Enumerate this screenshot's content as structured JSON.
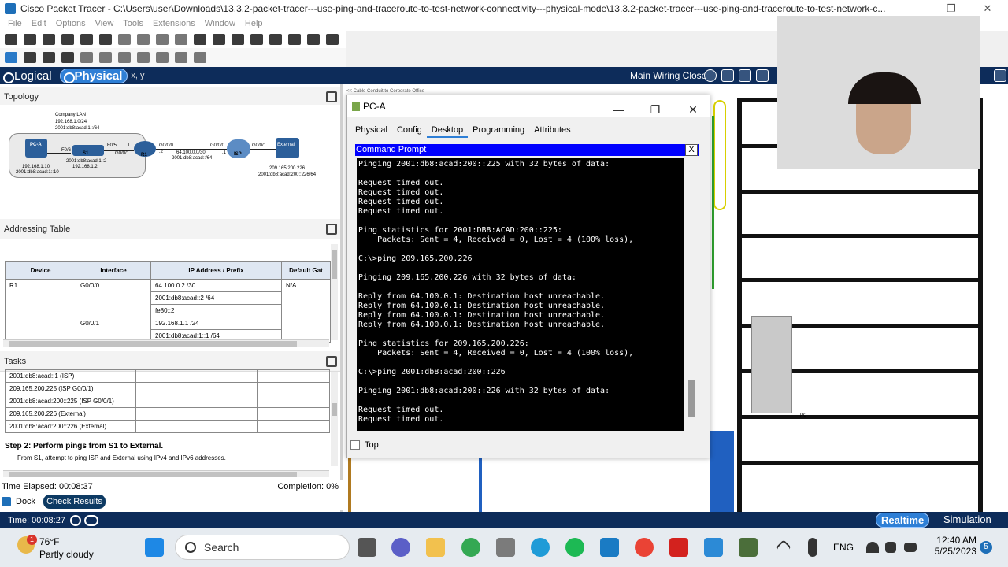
{
  "window": {
    "title": "Cisco Packet Tracer - C:\\Users\\user\\Downloads\\13.3.2-packet-tracer---use-ping-and-traceroute-to-test-network-connectivity---physical-mode\\13.3.2-packet-tracer---use-ping-and-traceroute-to-test-network-c...",
    "minimize": "—",
    "maximize": "❐",
    "close": "✕"
  },
  "menu": [
    "File",
    "Edit",
    "Options",
    "View",
    "Tools",
    "Extensions",
    "Window",
    "Help"
  ],
  "modebar": {
    "logical": "Logical",
    "physical": "Physical",
    "xy": "x, y",
    "location": "Main Wiring Closet"
  },
  "topology": {
    "header": "Topology",
    "lan_label": "Company LAN",
    "lan_net": "192.168.1.0/24",
    "lan_v6": "2001:db8:acad:1::/64",
    "pca": "PC-A",
    "pca_ip": "192.168.1.10",
    "pca_v6": "2001:db8:acad:1::10",
    "s1": "S1",
    "s1_v6": "2001:db8:acad:1::2",
    "s1_ip": "192.168.1.2",
    "f06": "F0/6",
    "f05": "F0/5",
    "g001": "G0/0/1",
    "r1": "R1",
    "g000": "G0/0/0",
    "wan_net": "64.100.0.0/30",
    "wan_v6": "2001:db8:acad::/64",
    "isp": "ISP",
    "isp_g000": "G0/0/0",
    "isp_g001": "G0/0/1",
    "external": "External",
    "ext_ip": "209.165.200.226",
    "ext_v6": "2001:db8:acad:200::226/64",
    "dot1": ".1",
    "dot2": ".2",
    "dot1b": ".1"
  },
  "addressing": {
    "header": "Addressing Table",
    "columns": [
      "Device",
      "Interface",
      "IP Address / Prefix",
      "Default Gat"
    ],
    "rows": [
      [
        "R1",
        "G0/0/0",
        "64.100.0.2 /30",
        "N/A"
      ],
      [
        "",
        "",
        "2001:db8:acad::2 /64",
        ""
      ],
      [
        "",
        "",
        "fe80::2",
        ""
      ],
      [
        "",
        "G0/0/1",
        "192.168.1.1 /24",
        ""
      ],
      [
        "",
        "",
        "2001:db8:acad:1::1 /64",
        ""
      ]
    ]
  },
  "tasks": {
    "header": "Tasks",
    "rows": [
      "2001:db8:acad::1 (ISP)",
      "209.165.200.225 (ISP G0/0/1)",
      "2001:db8:acad:200::225 (ISP G0/0/1)",
      "209.165.200.226 (External)",
      "2001:db8:acad:200::226 (External)"
    ],
    "step_title": "Step 2: Perform pings from S1 to External.",
    "step_desc": "From S1, attempt to ping ISP and External using IPv4 and IPv6 addresses."
  },
  "footer": {
    "elapsed": "Time Elapsed: 00:08:37",
    "completion": "Completion: 0%",
    "dock": "Dock",
    "check": "Check Results",
    "time": "Time: 00:08:27",
    "realtime": "Realtime",
    "simulation": "Simulation"
  },
  "pcwin": {
    "title": "PC-A",
    "tabs": [
      "Physical",
      "Config",
      "Desktop",
      "Programming",
      "Attributes"
    ],
    "active_tab": "Desktop",
    "cmd_title": "Command Prompt",
    "cmd_close": "X",
    "top_label": "Top",
    "terminal": "Pinging 2001:db8:acad:200::225 with 32 bytes of data:\n\nRequest timed out.\nRequest timed out.\nRequest timed out.\nRequest timed out.\n\nPing statistics for 2001:DB8:ACAD:200::225:\n    Packets: Sent = 4, Received = 0, Lost = 4 (100% loss),\n\nC:\\>ping 209.165.200.226\n\nPinging 209.165.200.226 with 32 bytes of data:\n\nReply from 64.100.0.1: Destination host unreachable.\nReply from 64.100.0.1: Destination host unreachable.\nReply from 64.100.0.1: Destination host unreachable.\nReply from 64.100.0.1: Destination host unreachable.\n\nPing statistics for 209.165.200.226:\n    Packets: Sent = 4, Received = 0, Lost = 4 (100% loss),\n\nC:\\>ping 2001:db8:acad:200::226\n\nPinging 2001:db8:acad:200::226 with 32 bytes of data:\n\nRequest timed out.\nRequest timed out.\n"
  },
  "workspace": {
    "breadcrumb": "<< Cable Conduit to Corporate Office",
    "pc_label": "PC"
  },
  "taskbar": {
    "weather_temp": "76°F",
    "weather_desc": "Partly cloudy",
    "weather_badge": "1",
    "search": "Search",
    "lang": "ENG",
    "time": "12:40 AM",
    "date": "5/25/2023",
    "notif": "5"
  },
  "colors": {
    "modebar": "#0d2c5a",
    "accent": "#2e7fd6",
    "cmd_header": "#0000ff"
  }
}
